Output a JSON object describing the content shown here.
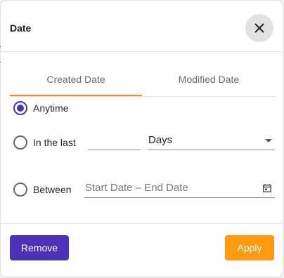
{
  "dialog": {
    "title": "Date",
    "close_icon": "close-icon"
  },
  "tabs": [
    {
      "label": "Created Date",
      "active": true
    },
    {
      "label": "Modified Date",
      "active": false
    }
  ],
  "options": {
    "anytime": {
      "label": "Anytime",
      "checked": true
    },
    "in_the_last": {
      "label": "In the last",
      "checked": false,
      "number_value": "",
      "unit_value": "Days"
    },
    "between": {
      "label": "Between",
      "checked": false,
      "placeholder": "Start Date – End Date"
    }
  },
  "icons": {
    "dropdown": "caret-down-icon",
    "calendar": "calendar-icon"
  },
  "buttons": {
    "remove": "Remove",
    "apply": "Apply"
  },
  "colors": {
    "primary": "#4a32b9",
    "accent": "#ff9a0e",
    "tab_indicator": "#f08c1a"
  }
}
